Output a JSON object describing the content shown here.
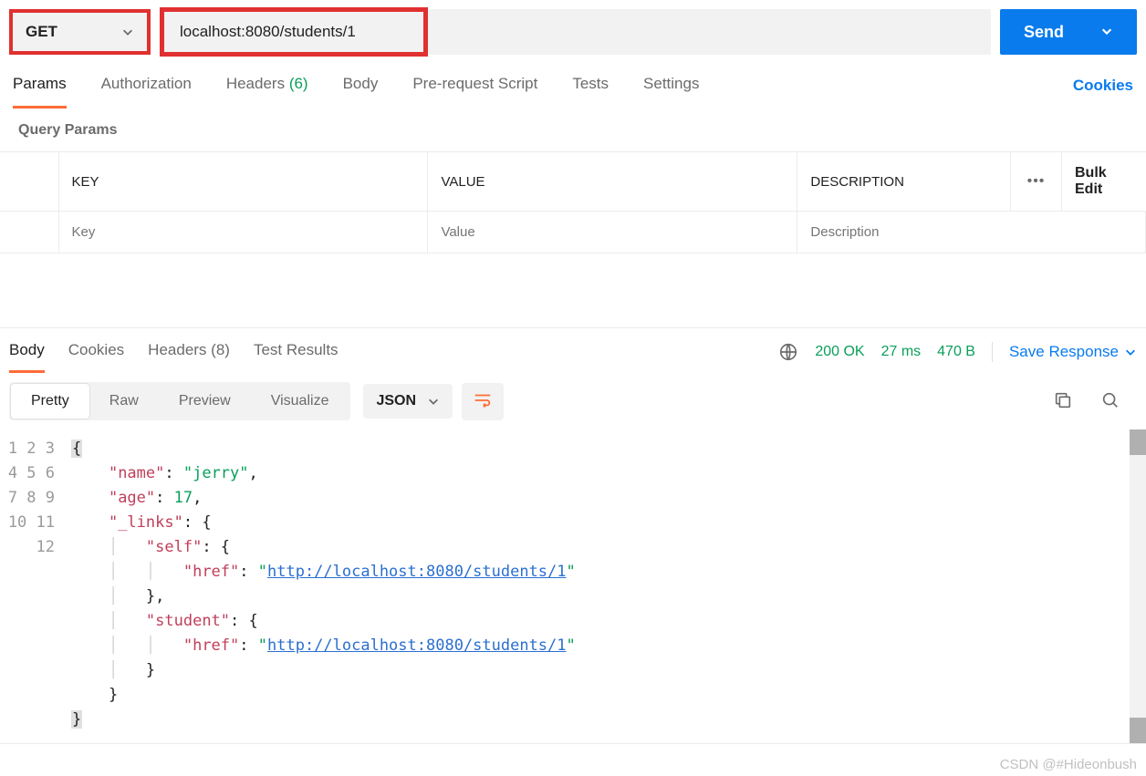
{
  "request": {
    "method": "GET",
    "url": "localhost:8080/students/1",
    "send_label": "Send"
  },
  "request_tabs": {
    "params": "Params",
    "authorization": "Authorization",
    "headers_label": "Headers",
    "headers_count": "(6)",
    "body": "Body",
    "prerequest": "Pre-request Script",
    "tests": "Tests",
    "settings": "Settings",
    "cookies": "Cookies"
  },
  "query_params": {
    "title": "Query Params",
    "headers": {
      "key": "KEY",
      "value": "VALUE",
      "description": "DESCRIPTION"
    },
    "placeholders": {
      "key": "Key",
      "value": "Value",
      "description": "Description"
    },
    "bulk_edit": "Bulk Edit"
  },
  "response_tabs": {
    "body": "Body",
    "cookies": "Cookies",
    "headers_label": "Headers",
    "headers_count": "(8)",
    "test_results": "Test Results"
  },
  "response_status": {
    "status": "200 OK",
    "time": "27 ms",
    "size": "470 B",
    "save_label": "Save Response"
  },
  "response_view": {
    "pretty": "Pretty",
    "raw": "Raw",
    "preview": "Preview",
    "visualize": "Visualize",
    "format": "JSON"
  },
  "response_body": {
    "name_key": "\"name\"",
    "name_val": "\"jerry\"",
    "age_key": "\"age\"",
    "age_val": "17",
    "links_key": "\"_links\"",
    "self_key": "\"self\"",
    "href_key": "\"href\"",
    "href_q": "\"",
    "href_url": "http://localhost:8080/students/1",
    "student_key": "\"student\""
  },
  "watermark": "CSDN @#Hideonbush"
}
